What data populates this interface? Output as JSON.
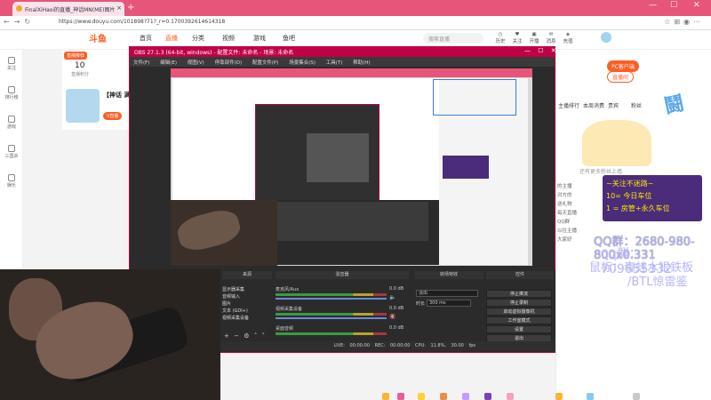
{
  "browser": {
    "tab_title": "FinalXiHaoi的直播_神话MN(ME)图片",
    "new_tab": "+",
    "url": "https://www.douyu.com/101898?71?_r=0.1700392614614318",
    "win_min": "—",
    "win_max": "☐",
    "win_close": "✕"
  },
  "douyu": {
    "logo": "斗鱼",
    "nav": [
      "首页",
      "直播",
      "分类",
      "视频",
      "游戏",
      "鱼吧"
    ],
    "search_placeholder": "搜索直播",
    "header_icons": [
      "历史",
      "关注",
      "开播",
      "消息",
      "充值"
    ]
  },
  "sidebar": {
    "items": [
      "关注",
      "排行榜",
      "游戏",
      "三国杀",
      "娱乐"
    ]
  },
  "room": {
    "rec_badge": "直播推荐",
    "rec_number": "10",
    "rec_sub": "直播积分",
    "host_name": "【神话 满",
    "v_badge": "V直播"
  },
  "obs": {
    "title": "OBS 27.1.3 (64-bit, windows) - 配置文件: 未命名 - 场景: 未命名",
    "menu": [
      "文件(F)",
      "编辑(E)",
      "视图(V)",
      "停靠部件(D)",
      "配置文件(P)",
      "场景集合(S)",
      "工具(T)",
      "帮助(H)"
    ],
    "dock_headers": [
      "来源",
      "混音器",
      "转场特效",
      "控件"
    ],
    "sources": [
      "显示器采集",
      "音频输入",
      "图片",
      "文本 (GDI+)",
      "视频采集设备"
    ],
    "mixer": [
      {
        "name": "麦克风/Aux",
        "value": "0.0 dB"
      },
      {
        "name": "视频采集设备",
        "value": "0.0 dB"
      },
      {
        "name": "桌面音频",
        "value": "0.0 dB"
      }
    ],
    "transition_select": "淡出",
    "duration_label": "时长",
    "duration_value": "300 ms",
    "controls": [
      "停止推流",
      "停止录制",
      "启动虚拟摄像机",
      "工作室模式",
      "设置",
      "退出"
    ],
    "status": "LIVE: 00:00:00   REC: 00:00:00   CPU: 11.8%, 30.00 fps"
  },
  "chat": {
    "pc_button": "PC客户端",
    "pc_button2": "直播间",
    "tabs": [
      "主播排行",
      "本周消费",
      "贵宾",
      "粉丝"
    ],
    "anime_label": "还有更多粉丝上墙",
    "chat_lines": [
      "的主播",
      "对方的",
      "送礼物",
      "每天直播",
      "QQ群",
      "以往主播",
      "大家好"
    ]
  },
  "overlay": {
    "banner_lines": [
      "~关注不迷路~",
      "10= 今日车位",
      "1 = 房管+永久车位"
    ],
    "qq_group_line": "QQ群：2680-980-800x0.331",
    "qq_line": "qq群：709655332",
    "mouse_line": "鼠标：毒蛙水银鉄板",
    "btl_line": "/BTL惊雷鉴"
  },
  "colors": {
    "browser_accent": "#e8557a",
    "douyu_orange": "#ff5d23",
    "obs_title": "#c00046",
    "banner_bg": "#4a2c7a",
    "banner_text": "#ffe600",
    "overlay_text": "#b5b6ff"
  }
}
